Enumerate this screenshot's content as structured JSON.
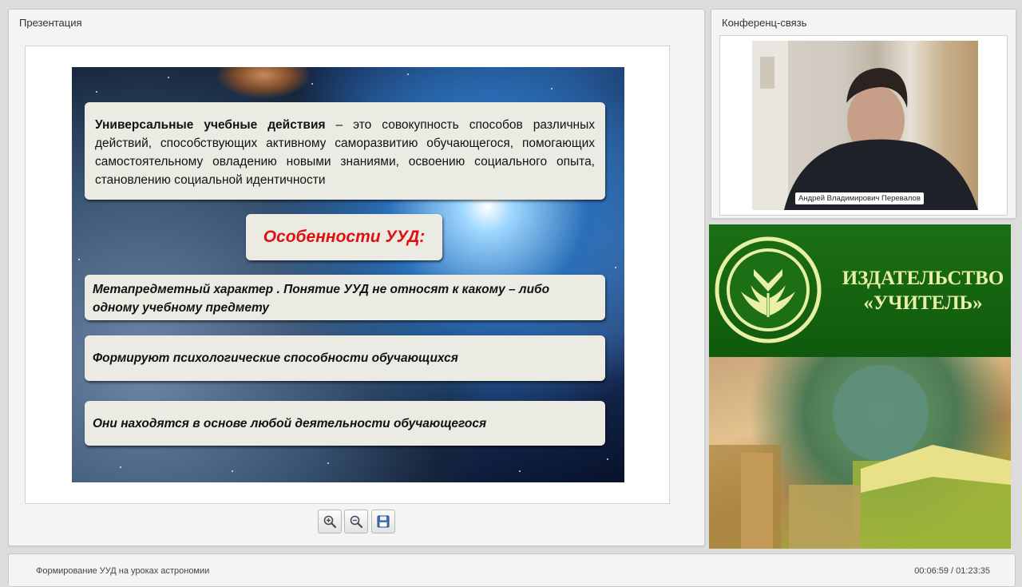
{
  "presentation": {
    "title": "Презентация",
    "slide": {
      "definition_term": "Универсальные учебные действия",
      "definition_rest": " – это совокупность способов различных действий, способствующих активному саморазвитию обучающегося, помогающих самостоятельному овладению новыми знаниями, освоению социального опыта, становлению социальной идентичности",
      "features_heading": "Особенности УУД:",
      "features": [
        "Метапредметный характер . Понятие УУД не относят к какому – либо одному учебному предмету",
        "Формируют психологические способности обучающихся",
        "Они находятся в основе любой деятельности обучающегося"
      ]
    },
    "controls": [
      "zoom-in-icon",
      "zoom-out-icon",
      "save-icon"
    ]
  },
  "conference": {
    "title": "Конференц-связь",
    "speaker_name": "Андрей Владимирович Перевалов"
  },
  "banner": {
    "line1": "ИЗДАТЕЛЬСТВО",
    "line2": "«УЧИТЕЛЬ»"
  },
  "footer": {
    "lecture_title": "Формирование УУД на уроках астрономии",
    "time": "00:06:59 / 01:23:35"
  },
  "colors": {
    "heading_red": "#e01010",
    "banner_green": "#1c6f14",
    "banner_text": "#e7f0a4"
  }
}
